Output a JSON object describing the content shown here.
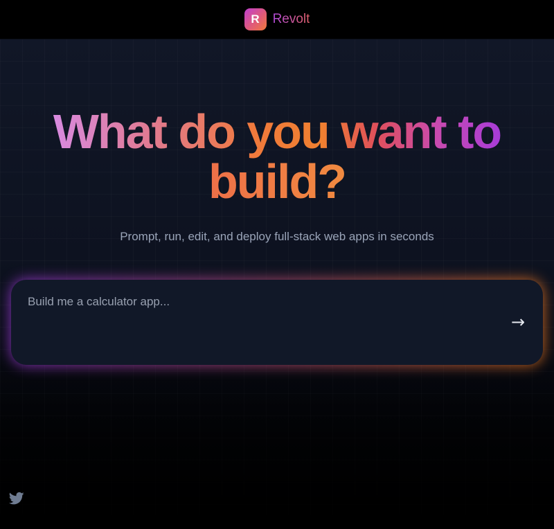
{
  "header": {
    "logo_letter": "R",
    "brand_name": "Revolt"
  },
  "hero": {
    "headline_line1": "What do you want to",
    "headline_line2": "build?",
    "subtitle": "Prompt, run, edit, and deploy full-stack web apps in seconds"
  },
  "prompt": {
    "placeholder": "Build me a calculator app...",
    "value": "",
    "send_icon": "arrow-right-icon",
    "send_glyph": "→"
  },
  "footer": {
    "social_icon": "twitter-icon"
  },
  "colors": {
    "brand_purple": "#a83cd8",
    "brand_orange": "#f07a22",
    "background": "#111727"
  }
}
